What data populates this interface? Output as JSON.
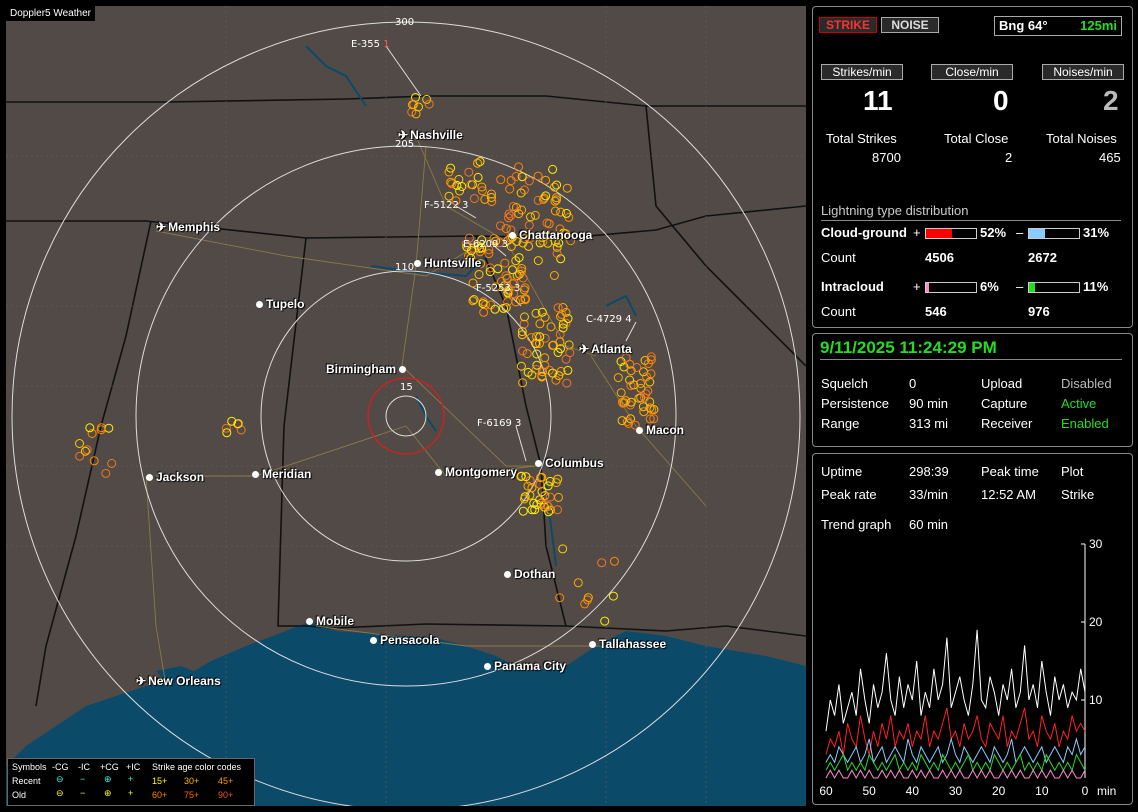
{
  "brand": "Doppler5 Weather",
  "map": {
    "rings": [
      "300",
      "205",
      "110",
      "15"
    ],
    "cities": [
      {
        "name": "Nashville",
        "icon": "plane"
      },
      {
        "name": "Memphis",
        "icon": "plane"
      },
      {
        "name": "Chattanooga",
        "icon": "dot"
      },
      {
        "name": "Huntsville",
        "icon": "dot"
      },
      {
        "name": "Tupelo",
        "icon": "dot"
      },
      {
        "name": "Atlanta",
        "icon": "plane"
      },
      {
        "name": "Birmingham",
        "icon": "dot"
      },
      {
        "name": "Macon",
        "icon": "dot"
      },
      {
        "name": "Jackson",
        "icon": "dot"
      },
      {
        "name": "Meridian",
        "icon": "dot"
      },
      {
        "name": "Montgomery",
        "icon": "dot"
      },
      {
        "name": "Columbus",
        "icon": "dot"
      },
      {
        "name": "Dothan",
        "icon": "dot"
      },
      {
        "name": "Mobile",
        "icon": "dot"
      },
      {
        "name": "Pensacola",
        "icon": "dot"
      },
      {
        "name": "Tallahassee",
        "icon": "dot"
      },
      {
        "name": "Panama City",
        "icon": "dot"
      },
      {
        "name": "New Orleans",
        "icon": "plane"
      }
    ],
    "storm_labels": [
      "E-355",
      "1",
      "F-5122",
      "3",
      "E-6209",
      "3",
      "F-5253",
      "3",
      "C-4729",
      "4",
      "F-6169",
      "3"
    ]
  },
  "legend": {
    "header": [
      "Symbols",
      "-CG",
      "-IC",
      "+CG",
      "+IC",
      "Strike age color codes"
    ],
    "recent": {
      "label": "Recent",
      "ages": [
        "15+",
        "30+",
        "45+"
      ]
    },
    "old": {
      "label": "Old",
      "ages": [
        "60+",
        "75+",
        "90+"
      ]
    }
  },
  "top": {
    "strike_btn": "STRIKE",
    "noise_btn": "NOISE",
    "bearing": "Bng 64°",
    "distance": "125mi",
    "rates": [
      {
        "label": "Strikes/min",
        "value": "11"
      },
      {
        "label": "Close/min",
        "value": "0"
      },
      {
        "label": "Noises/min",
        "value": "2"
      }
    ],
    "totals": [
      {
        "label": "Total Strikes",
        "value": "8700"
      },
      {
        "label": "Total Close",
        "value": "2"
      },
      {
        "label": "Total Noises",
        "value": "465"
      }
    ],
    "dist_title": "Lightning type distribution",
    "cg_label": "Cloud-ground",
    "ic_label": "Intracloud",
    "count_label": "Count",
    "plus": "+",
    "minus": "–",
    "cg_pos_pct": "52%",
    "cg_neg_pct": "31%",
    "cg_pos_count": "4506",
    "cg_neg_count": "2672",
    "ic_pos_pct": "6%",
    "ic_neg_pct": "11%",
    "ic_pos_count": "546",
    "ic_neg_count": "976",
    "cg_pos_frac": 0.52,
    "cg_neg_frac": 0.31,
    "ic_pos_frac": 0.06,
    "ic_neg_frac": 0.11,
    "colors": {
      "cg_pos": "#ff0000",
      "cg_neg": "#88ccff",
      "ic_pos": "#ff88cc",
      "ic_neg": "#22dd22"
    }
  },
  "status": {
    "datetime": "9/11/2025 11:24:29 PM",
    "squelch_label": "Squelch",
    "squelch": "0",
    "persistence_label": "Persistence",
    "persistence": "90 min",
    "range_label": "Range",
    "range": "313 mi",
    "upload_label": "Upload",
    "upload": "Disabled",
    "capture_label": "Capture",
    "capture": "Active",
    "receiver_label": "Receiver",
    "receiver": "Enabled"
  },
  "stats": {
    "uptime_label": "Uptime",
    "uptime": "298:39",
    "peak_time_label": "Peak time",
    "peak_time": "12:52 AM",
    "plot_label": "Plot",
    "plot": "Strike",
    "peak_rate_label": "Peak rate",
    "peak_rate": "33/min",
    "trend_label": "Trend graph",
    "trend": "60 min"
  },
  "chart_data": {
    "type": "line",
    "x_ticks": [
      "60",
      "50",
      "40",
      "30",
      "20",
      "10",
      "0"
    ],
    "x_unit": "min",
    "y_ticks": [
      "30",
      "20",
      "10"
    ],
    "ylim": [
      0,
      30
    ],
    "xlim": [
      60,
      0
    ],
    "series": [
      {
        "color": "#ffffff",
        "values": [
          6,
          10,
          8,
          12,
          7,
          9,
          11,
          8,
          14,
          10,
          7,
          12,
          9,
          11,
          16,
          10,
          8,
          13,
          9,
          12,
          10,
          15,
          8,
          11,
          9,
          14,
          10,
          12,
          18,
          9,
          11,
          13,
          10,
          8,
          12,
          19,
          10,
          9,
          13,
          11,
          8,
          12,
          10,
          14,
          9,
          11,
          17,
          10,
          12,
          9,
          15,
          11,
          8,
          13,
          10,
          12,
          9,
          11,
          10,
          14,
          11
        ]
      },
      {
        "color": "#ff2020",
        "values": [
          3,
          5,
          4,
          6,
          3,
          7,
          5,
          4,
          8,
          5,
          3,
          6,
          4,
          7,
          5,
          8,
          4,
          6,
          5,
          7,
          4,
          6,
          5,
          8,
          4,
          6,
          5,
          7,
          9,
          5,
          6,
          4,
          7,
          5,
          6,
          8,
          5,
          4,
          7,
          6,
          5,
          8,
          4,
          6,
          5,
          7,
          9,
          5,
          6,
          4,
          8,
          6,
          5,
          7,
          4,
          6,
          5,
          8,
          6,
          7,
          6
        ]
      },
      {
        "color": "#88ccff",
        "values": [
          2,
          3,
          2,
          4,
          3,
          2,
          3,
          4,
          2,
          3,
          5,
          2,
          3,
          4,
          2,
          3,
          4,
          3,
          2,
          5,
          3,
          2,
          4,
          3,
          2,
          3,
          4,
          2,
          3,
          5,
          3,
          2,
          4,
          3,
          2,
          3,
          4,
          3,
          2,
          4,
          3,
          2,
          3,
          5,
          2,
          3,
          4,
          3,
          2,
          3,
          4,
          2,
          3,
          4,
          3,
          2,
          4,
          3,
          5,
          3,
          4
        ]
      },
      {
        "color": "#22dd22",
        "values": [
          1,
          2,
          1,
          2,
          3,
          1,
          2,
          1,
          2,
          1,
          3,
          2,
          1,
          2,
          1,
          2,
          3,
          1,
          2,
          1,
          2,
          1,
          3,
          2,
          1,
          2,
          1,
          3,
          2,
          1,
          2,
          1,
          2,
          3,
          1,
          2,
          1,
          2,
          1,
          3,
          2,
          1,
          2,
          1,
          2,
          3,
          1,
          2,
          1,
          2,
          1,
          3,
          2,
          1,
          2,
          1,
          2,
          1,
          3,
          2,
          1
        ]
      },
      {
        "color": "#ff88cc",
        "values": [
          0,
          1,
          0,
          1,
          0,
          0,
          1,
          0,
          1,
          0,
          1,
          0,
          0,
          1,
          0,
          1,
          0,
          1,
          0,
          0,
          1,
          0,
          1,
          0,
          1,
          0,
          0,
          1,
          0,
          1,
          0,
          1,
          0,
          0,
          1,
          0,
          1,
          0,
          1,
          0,
          0,
          1,
          0,
          1,
          0,
          1,
          0,
          0,
          1,
          0,
          1,
          0,
          1,
          0,
          0,
          1,
          0,
          1,
          0,
          0,
          1
        ]
      }
    ]
  }
}
